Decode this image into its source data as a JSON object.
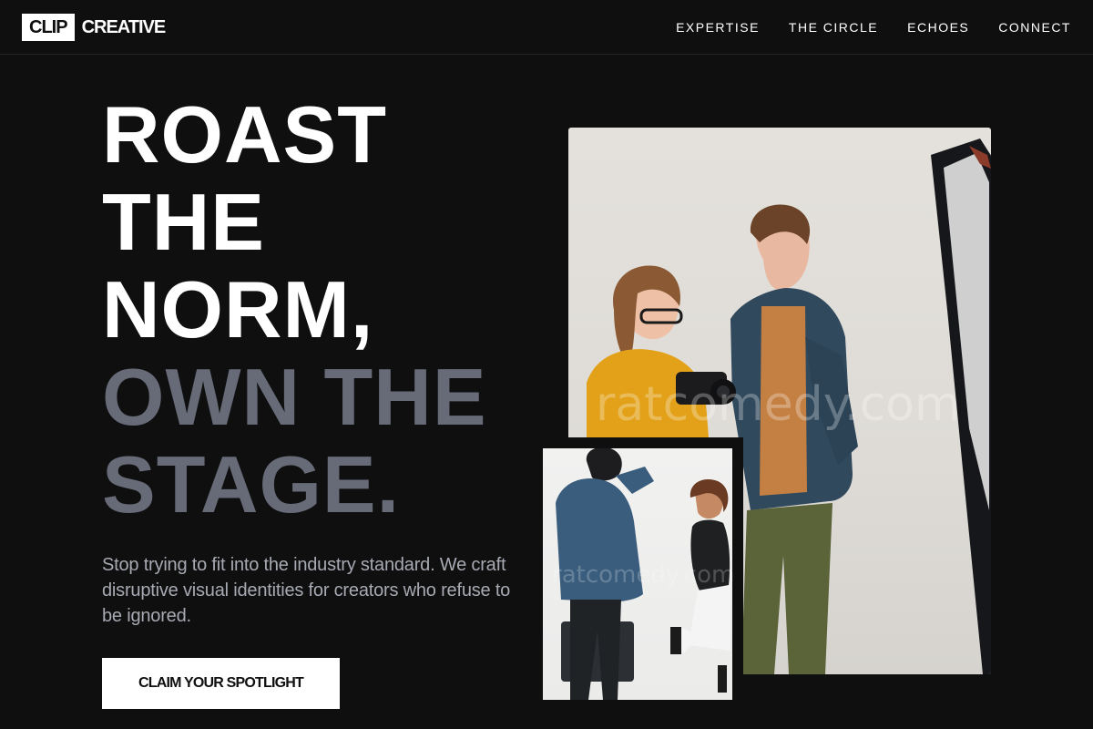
{
  "brand": {
    "logo_box": "CLIP",
    "logo_word": "CREATIVE"
  },
  "nav": {
    "items": [
      {
        "label": "EXPERTISE"
      },
      {
        "label": "THE CIRCLE"
      },
      {
        "label": "ECHOES"
      },
      {
        "label": "CONNECT"
      }
    ]
  },
  "hero": {
    "headline_lines": [
      "ROAST",
      "THE",
      "NORM,"
    ],
    "headline_muted_lines": [
      "OWN THE",
      "STAGE."
    ],
    "lede": "Stop trying to fit into the industry standard. We craft disruptive visual identities for creators who refuse to be ignored.",
    "cta_label": "CLAIM YOUR SPOTLIGHT"
  },
  "images": {
    "main_watermark": "ratcomedy.com",
    "small_watermark": "ratcomedy.com"
  },
  "colors": {
    "background": "#0f0f10",
    "text": "#ffffff",
    "muted_headline": "#676b78",
    "body_text": "#a7aab2",
    "button_bg": "#ffffff"
  }
}
